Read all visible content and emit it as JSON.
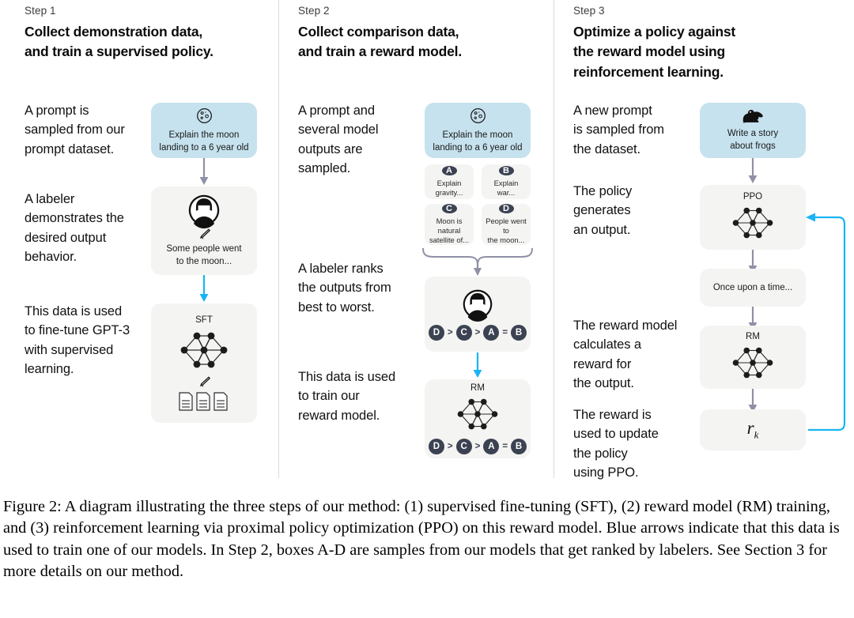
{
  "figure": {
    "caption": "Figure 2: A diagram illustrating the three steps of our method: (1) supervised fine-tuning (SFT), (2) reward model (RM) training, and (3) reinforcement learning via proximal policy optimization (PPO) on this reward model. Blue arrows indicate that this data is used to train one of our models. In Step 2, boxes A-D are samples from our models that get ranked by labelers. See Section 3 for more details on our method."
  },
  "colors": {
    "blue_card": "#c6e2ee",
    "gray_card": "#f4f4f2",
    "blue_arrow": "#18b4f4",
    "gray_arrow": "#8f90a6",
    "badge": "#3b4252",
    "divider": "#d9d9d9"
  },
  "steps": [
    {
      "label": "Step 1",
      "title": "Collect demonstration data,\nand train a supervised policy.",
      "descriptions": [
        "A prompt is\nsampled from our\nprompt dataset.",
        "A labeler\ndemonstrates the\ndesired output\nbehavior.",
        "This data is used\nto fine-tune GPT-3\nwith supervised\nlearning."
      ],
      "cards": [
        {
          "name": "prompt-card",
          "icon": "moon-icon",
          "text": "Explain the moon\nlanding to a 6 year old"
        },
        {
          "name": "labeler-card",
          "icon": "person-icon",
          "secondary_icon": "pencil-icon",
          "text": "Some people went\nto the moon..."
        },
        {
          "name": "sft-card",
          "label": "SFT",
          "icon": "neural-network-icon",
          "secondary_icon": "pencil-icon",
          "tertiary_icon": "documents-icon"
        }
      ]
    },
    {
      "label": "Step 2",
      "title": "Collect comparison data,\nand train a reward model.",
      "descriptions": [
        "A prompt and\nseveral model\noutputs are\nsampled.",
        "A labeler ranks\nthe outputs from\nbest to worst.",
        "This data is used\nto train our\nreward model."
      ],
      "cards": [
        {
          "name": "prompt-card",
          "icon": "moon-icon",
          "text": "Explain the moon\nlanding to a 6 year old"
        },
        {
          "name": "ranking-card",
          "icon": "person-icon",
          "ranking": "D > C > A = B"
        },
        {
          "name": "rm-card",
          "label": "RM",
          "icon": "neural-network-icon",
          "ranking": "D > C > A = B"
        }
      ],
      "samples": [
        {
          "badge": "A",
          "text": "Explain gravity..."
        },
        {
          "badge": "B",
          "text": "Explain war..."
        },
        {
          "badge": "C",
          "text": "Moon is natural\nsatellite of..."
        },
        {
          "badge": "D",
          "text": "People went to\nthe moon..."
        }
      ],
      "ranking_parts": [
        "D",
        ">",
        "C",
        ">",
        "A",
        "=",
        "B"
      ]
    },
    {
      "label": "Step 3",
      "title": "Optimize a policy against\nthe reward model using\nreinforcement learning.",
      "descriptions": [
        "A new prompt\nis sampled from\nthe dataset.",
        "The policy\ngenerates\nan output.",
        "The reward model\ncalculates a\nreward for\nthe output.",
        "The reward is\nused to update\nthe policy\nusing PPO."
      ],
      "cards": [
        {
          "name": "new-prompt-card",
          "icon": "frog-icon",
          "text": "Write a story\nabout frogs"
        },
        {
          "name": "ppo-card",
          "label": "PPO",
          "icon": "neural-network-icon"
        },
        {
          "name": "output-card",
          "text": "Once upon a time..."
        },
        {
          "name": "rm-card",
          "label": "RM",
          "icon": "neural-network-icon"
        },
        {
          "name": "reward-card",
          "reward_symbol": "r",
          "reward_subscript": "k"
        }
      ]
    }
  ]
}
